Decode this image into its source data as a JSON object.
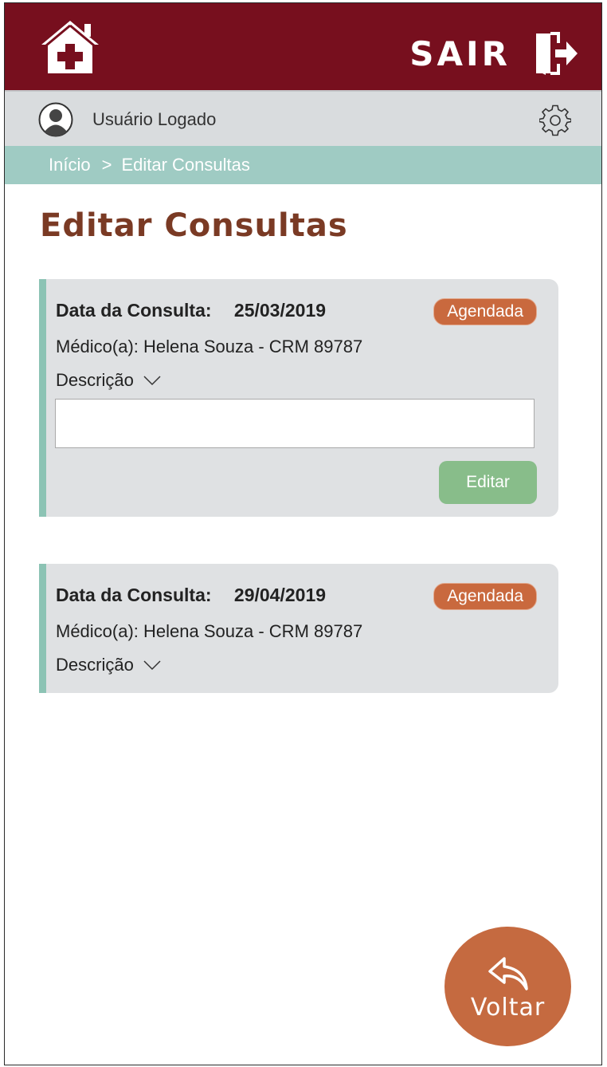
{
  "header": {
    "logout_label": "SAIR",
    "colors": {
      "bar": "#770f1e",
      "logo_cross": "#770f1e"
    },
    "icons": {
      "home": "home-medical-icon",
      "logout": "exit-door-icon"
    }
  },
  "user_bar": {
    "user_name": "Usuário Logado",
    "icons": {
      "avatar": "user-avatar-icon",
      "settings": "gear-icon"
    }
  },
  "breadcrumb": {
    "home": "Início",
    "separator": ">",
    "current": "Editar Consultas"
  },
  "page": {
    "title": "Editar Consultas"
  },
  "appointments": [
    {
      "date_label": "Data da Consulta:",
      "date": "25/03/2019",
      "status": "Agendada",
      "doctor": "Médico(a): Helena Souza - CRM 89787",
      "description_label": "Descrição",
      "description_value": "",
      "edit_label": "Editar"
    },
    {
      "date_label": "Data da Consulta:",
      "date": "29/04/2019",
      "status": "Agendada",
      "doctor": "Médico(a): Helena Souza - CRM 89787",
      "description_label": "Descrição"
    }
  ],
  "fab": {
    "label": "Voltar",
    "icon": "reply-arrow-icon"
  },
  "colors": {
    "status_badge": "#c9693e",
    "edit_button": "#88bd8a",
    "card_accent": "#8cc3b4",
    "title": "#7a3a24",
    "fab": "#c56a40"
  }
}
